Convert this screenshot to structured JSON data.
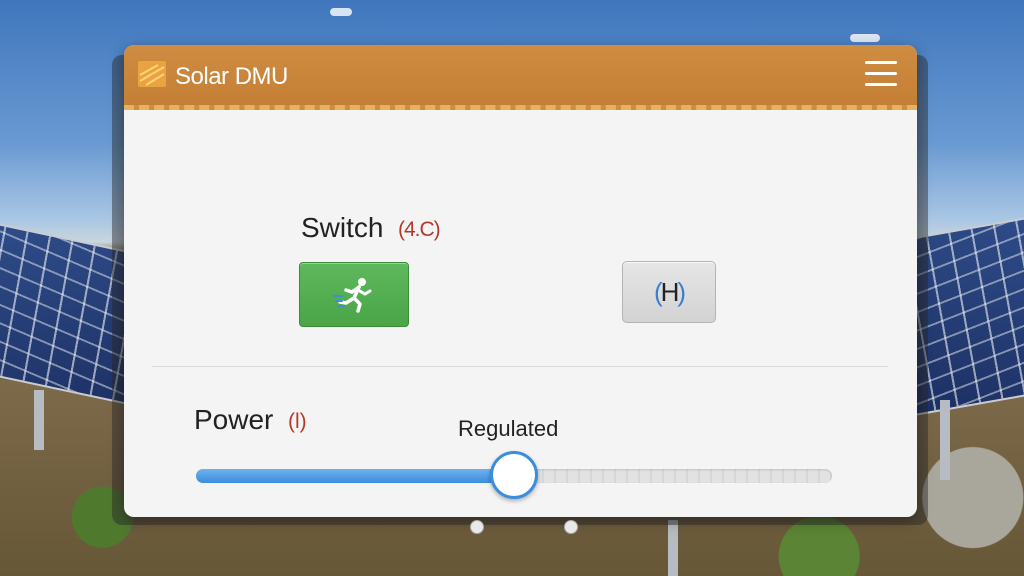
{
  "app": {
    "title": "Solar DMU",
    "logo_icon": "solar-logo-icon",
    "menu_icon": "hamburger-menu-icon",
    "accent_color": "#c98638"
  },
  "switch": {
    "label": "Switch",
    "badge": "(4.C)",
    "run_button": {
      "icon": "running-person-icon",
      "color": "#4aa547"
    },
    "hold_button": {
      "label_parts": [
        "(",
        "H",
        ")"
      ],
      "color": "#d9d9d9"
    }
  },
  "power": {
    "label": "Power",
    "badge": "(l)",
    "slider": {
      "value_label": "Regulated",
      "fraction": 0.5,
      "fill_color": "#3b8ddd"
    }
  }
}
